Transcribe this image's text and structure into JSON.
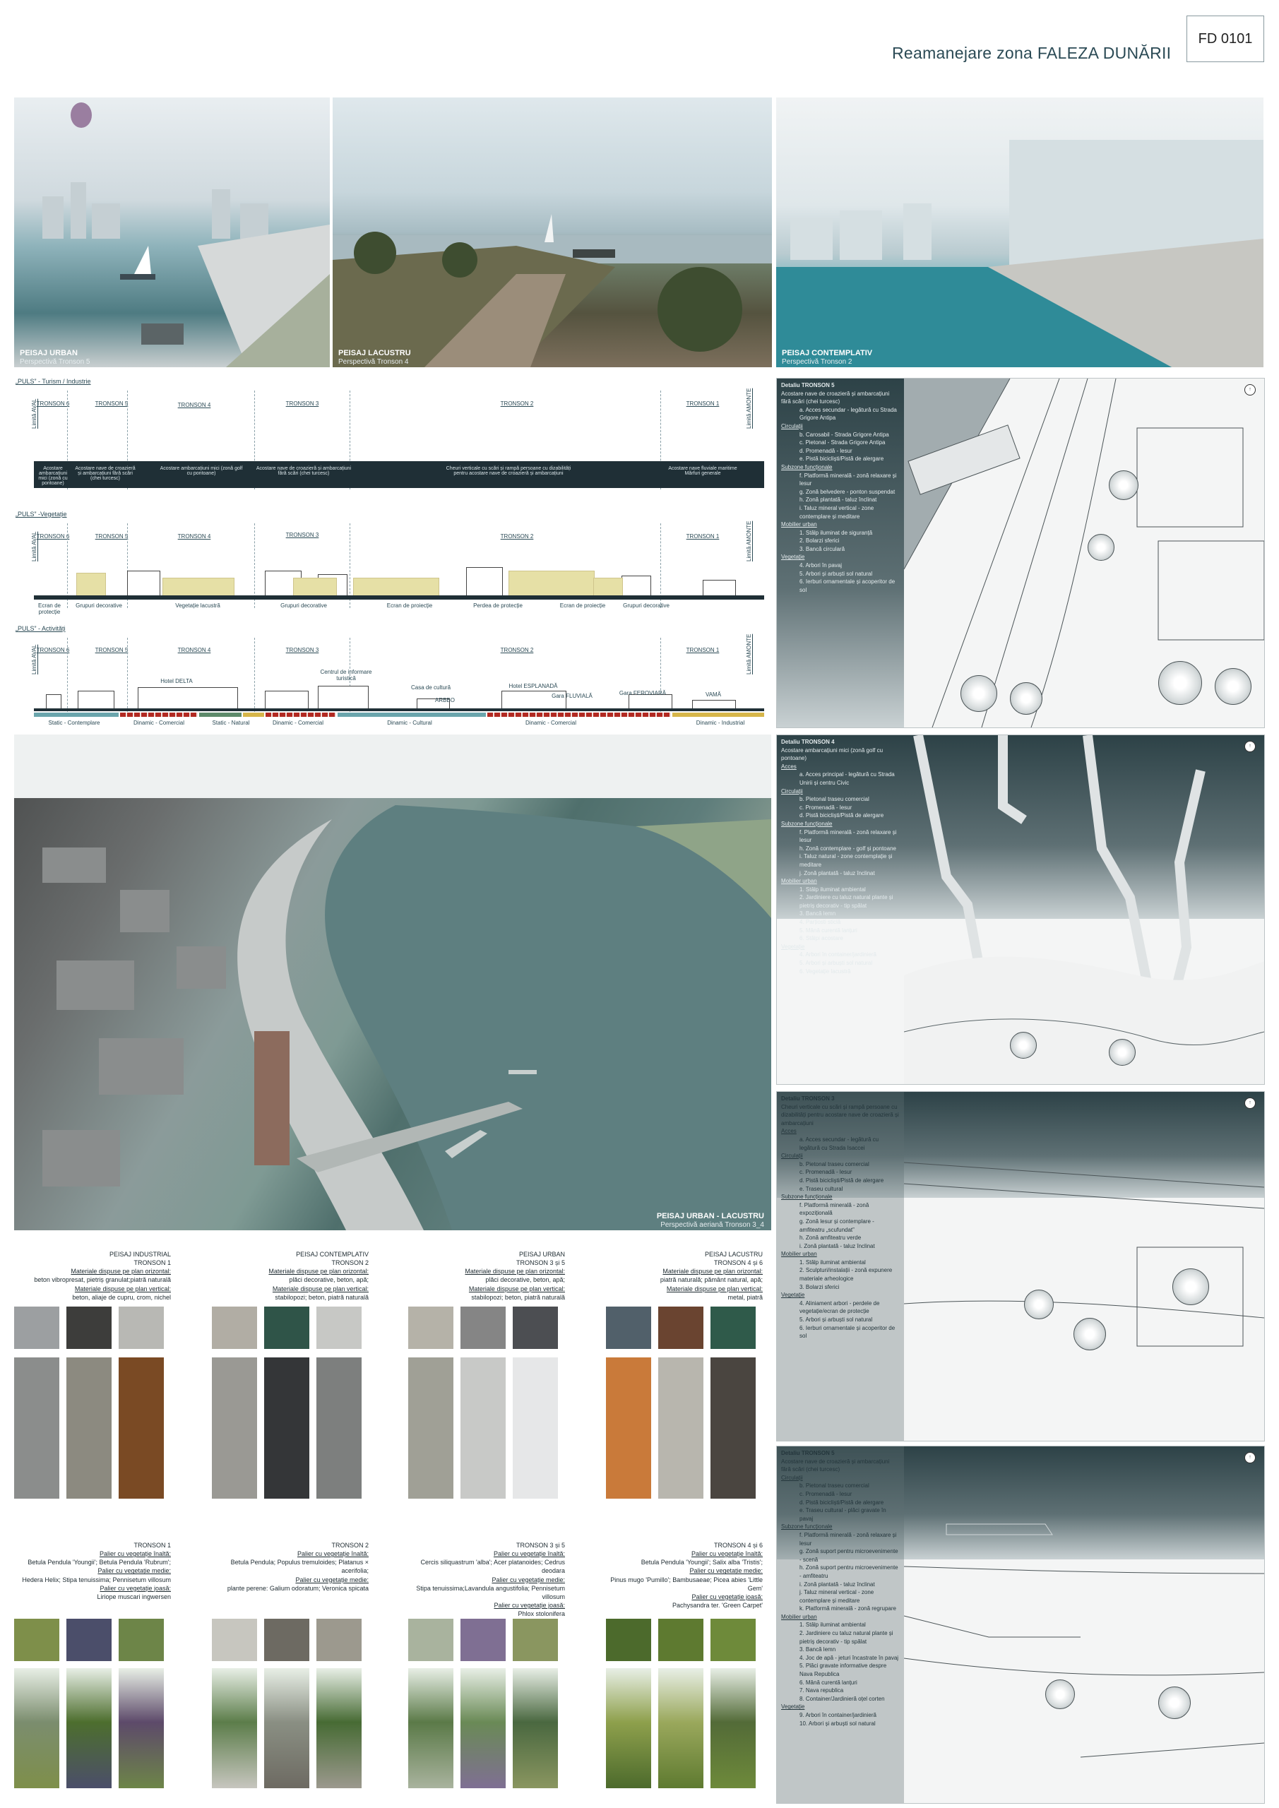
{
  "header": {
    "code": "FD 0101",
    "title": "Reamanejare zona FALEZA DUNĂRII"
  },
  "top_photos": [
    {
      "label": "PEISAJ URBAN",
      "sublabel": "Perspectivă Tronson 5"
    },
    {
      "label": "PEISAJ LACUSTRU",
      "sublabel": "Perspectivă Tronson 4"
    },
    {
      "label": "PEISAJ CONTEMPLATIV",
      "sublabel": "Perspectivă Tronson 2"
    }
  ],
  "sections": {
    "puls1": {
      "title": "„PULS” - Turism / Industrie"
    },
    "puls2": {
      "title": "„PULS” -Vegetație"
    },
    "puls3": {
      "title": "„PULS” - Activități"
    },
    "limit_left": "Limită AVAL",
    "limit_right": "Limită AMONTE",
    "tronsons": [
      "TRONSON 6",
      "TRONSON 5",
      "TRONSON 4",
      "TRONSON 3",
      "TRONSON 2",
      "TRONSON 1"
    ],
    "band1": [
      "Acostare ambarcațiuni mici (zonă cu pontoane)",
      "Acostare nave de croazieră și ambarcațiuni fără scări (chei turcesc)",
      "Acostare ambarcațiuni mici (zonă golf cu pontoane)",
      "Acostare nave de croazieră și ambarcațiuni fără scări (chei turcesc)",
      "Cheuri verticale cu scări și rampă persoane cu dizabilități pentru acostare nave de croazieră și ambarcațiuni",
      "Acostare nave fluviale maritime Mărfuri generale"
    ],
    "veg_caps": [
      "Ecran de protecție",
      "Grupuri decorative",
      "Vegetație lacustră",
      "Grupuri decorative",
      "Ecran de proiecție",
      "Perdea de protecție",
      "Ecran de proiecție",
      "Grupuri decorative"
    ],
    "act_labels": [
      "Hotel DELTA",
      "Centrul de informare turistică",
      "Casa de cultură",
      "ARBBO",
      "Hotel ESPLANADĂ",
      "Gara FLUVIALĂ",
      "Gara FEROVIARĂ",
      "VAMĂ"
    ],
    "act_caps": [
      "Static - Contemplare",
      "Dinamic - Comercial",
      "Static - Natural",
      "Dinamic - Comercial",
      "Dinamic - Cultural",
      "Dinamic - Comercial",
      "Dinamic - Industrial"
    ]
  },
  "aerial": {
    "label": "PEISAJ URBAN - LACUSTRU",
    "sublabel": "Perspectivă aeriană Tronson 3_4"
  },
  "details": [
    {
      "title": "Detaliu TRONSON 5",
      "subtitle": "Acostare nave de croazieră și ambarcațiuni fără scări (chei turcesc)",
      "lines": [
        "a. Acces secundar - legătură cu Strada Grigore Antipa",
        "Circulații",
        "b. Carosabil - Strada Grigore Antipa",
        "c. Pietonal - Strada Grigore Antipa",
        "d. Promenadă - lesur",
        "e. Pistă bicicliști/Pistă de alergare",
        "Subzone funcționale",
        "f. Platformă minerală - zonă relaxare și lesur",
        "g. Zonă belvedere - ponton suspendat",
        "h. Zonă plantată - taluz înclinat",
        "i. Taluz mineral vertical - zone contemplare și meditare",
        "Mobilier urban",
        "1. Stâlp iluminat de siguranță",
        "2. Bolarzi sferici",
        "3. Bancă circulară",
        "Vegetație",
        "4. Arbori în pavaj",
        "5. Arbori și arbuști sol natural",
        "6. Ierburi ornamentale și acoperitor de sol"
      ]
    },
    {
      "title": "Detaliu TRONSON 4",
      "subtitle": "Acostare ambarcațiuni mici (zonă golf cu pontoane)",
      "lines": [
        "Acces",
        "a. Acces principal - legătură cu Strada Unirii și centru Civic",
        "Circulații",
        "b. Pietonal traseu comercial",
        "c. Promenadă - lesur",
        "d. Pistă bicicliști/Pistă de alergare",
        "Subzone funcționale",
        "f. Platformă minerală - zonă relaxare și lesur",
        "h. Zonă contemplare - golf și pontoane",
        "i. Taluz natural - zone contemplație și meditare",
        "j. Zonă plantată - taluz înclinat",
        "Mobilier urban",
        "1. Stâlp iluminat ambiental",
        "2. Jardiniere cu taluz natural plante și pietriș decorativ - tip spălat",
        "3. Bancă lemn",
        "4. Parțiosti sticlă",
        "5. Mână curentă lanțuri",
        "6. Stâlpi acostare",
        "Vegetație",
        "4. Arbori în container/jardinieră",
        "5. Arbori și arbuști sol natural",
        "6. Vegetație lacustră"
      ]
    },
    {
      "title": "Detaliu TRONSON 3",
      "subtitle": "Cheuri verticale cu scări și rampă persoane cu dizabilități pentru acostare nave de croazieră și ambarcațiuni",
      "lines": [
        "Acces",
        "a. Acces secundar - legătură cu legătură cu Strada Isaccei",
        "Circulații",
        "b. Pietonal traseu comercial",
        "c. Promenadă - lesur",
        "d. Pistă bicicliști/Pistă de alergare",
        "e. Traseu cultural",
        "Subzone funcționale",
        "f. Platformă minerală - zonă expozițională",
        "g. Zonă lesur și contemplare - amfiteatru „scufundat”",
        "h. Zonă amfiteatru verde",
        "i. Zonă plantată - taluz înclinat",
        "Mobilier urban",
        "1. Stâlp iluminat ambiental",
        "2. Sculpturi/instalații - zonă expunere materiale arheologice",
        "3. Bolarzi sferici",
        "Vegetație",
        "4. Aliniament arbori - perdele de vegetație/ecran de protecție",
        "5. Arbori și arbuști sol natural",
        "6. Ierburi ornamentale și acoperitor de sol"
      ]
    },
    {
      "title": "Detaliu TRONSON 5",
      "subtitle": "Acostare nave de croazieră și ambarcațiuni fără scări (chei turcesc)",
      "lines": [
        "Circulații",
        "b. Pietonal traseu comercial",
        "c. Promenadă - lesur",
        "d. Pistă bicicliști/Pistă de alergare",
        "e. Traseu cultural - plăci gravate în pavaj",
        "Subzone funcționale",
        "f. Platformă minerală - zonă relaxare și lesur",
        "g. Zonă suport pentru microevenimente - scenă",
        "h. Zonă suport pentru microevenimente - amfiteatru",
        "i. Zonă plantată - taluz înclinat",
        "j. Taluz mineral vertical - zone contemplare și meditare",
        "k. Platformă minerală - zonă regrupare",
        "Mobilier urban",
        "1. Stâlp iluminat ambiental",
        "2. Jardiniere cu taluz natural plante și pietriș decorativ - tip spălat",
        "3. Bancă lemn",
        "4. Joc de apă - jeturi încastrate în pavaj",
        "5. Plăci gravate informative despre Nava Republica",
        "6. Mână curentă lanțuri",
        "7. Nava republica",
        "8. Container/Jardinieră oțel corten",
        "Vegetație",
        "9. Arbori în container/jardinieră",
        "10. Arbori și arbuști sol natural"
      ]
    }
  ],
  "materials": [
    {
      "name": "PEISAJ INDUSTRIAL",
      "tronson": "TRONSON 1",
      "h_label": "Materiale dispuse pe plan orizontal:",
      "h_text": "beton vibropresat, pietriș granulat;piatră naturală",
      "v_label": "Materiale dispuse pe plan vertical:",
      "v_text": "beton, aliaje de cupru, crom, nichel",
      "sw": [
        "#9c9fa1",
        "#3d3d3b",
        "#b8b8b4",
        "#8b8d8c",
        "#8c8a80",
        "#7a4a24"
      ]
    },
    {
      "name": "PEISAJ CONTEMPLATIV",
      "tronson": "TRONSON 2",
      "h_label": "Materiale dispuse pe plan orizontal:",
      "h_text": "plăci decorative, beton, apă;",
      "v_label": "Materiale dispuse pe plan vertical:",
      "v_text": "stabilopozi; beton, piatră naturală",
      "sw": [
        "#b1ada4",
        "#2f5448",
        "#c7c8c5",
        "#9a9994",
        "#343638",
        "#7d7f7e"
      ]
    },
    {
      "name": "PEISAJ URBAN",
      "tronson": "TRONSON 3 și 5",
      "h_label": "Materiale dispuse pe plan orizontal:",
      "h_text": "plăci decorative, beton, apă;",
      "v_label": "Materiale dispuse pe plan vertical:",
      "v_text": "stabilopozi; beton, piatră naturală",
      "sw": [
        "#b5b2a8",
        "#858585",
        "#4c4e52",
        "#a0a096",
        "#c8c9c7",
        "#e6e7e8"
      ]
    },
    {
      "name": "PEISAJ LACUSTRU",
      "tronson": "TRONSON 4 și 6",
      "h_label": "Materiale dispuse pe plan orizontal:",
      "h_text": "piatră naturală; pământ natural, apă;",
      "v_label": "Materiale dispuse pe plan vertical:",
      "v_text": "metal, piatră",
      "sw": [
        "#51606a",
        "#6a4430",
        "#2f5a4a",
        "#c97a3a",
        "#b8b6ae",
        "#4a4540"
      ]
    }
  ],
  "vegetation": [
    {
      "tronson": "TRONSON 1",
      "lines": [
        "Palier cu vegetație înaltă:",
        "Betula Pendula 'Youngii'; Betula Pendula 'Rubrum';",
        "Palier cu vegetație medie:",
        "Hedera Helix; Stipa tenuissima; Pennisetum villosum",
        "Palier cu vegetație joasă:",
        "Liriope muscari ingwersen"
      ],
      "sw": [
        "#7e8f4a",
        "#4b4e6a",
        "#6d8548",
        "#7b8d6e",
        "#4d6e2e",
        "#5d4a6a"
      ]
    },
    {
      "tronson": "TRONSON 2",
      "lines": [
        "Palier cu vegetație înaltă:",
        "Betula Pendula; Populus tremuloides; Platanus × acerifolia;",
        "Palier cu vegetație medie:",
        "plante perene: Galium odoratum; Veronica spicata"
      ],
      "sw": [
        "#c7c6bf",
        "#6d6a62",
        "#9c998e",
        "#5c7d4a",
        "#8a8f83",
        "#476b34"
      ]
    },
    {
      "tronson": "TRONSON 3 și 5",
      "lines": [
        "Palier cu vegetație înaltă:",
        "Cercis siliquastrum 'alba'; Acer platanoides; Cedrus deodara",
        "Palier cu vegetație medie:",
        "Stipa tenuissima;Lavandula angustifolia; Pennisetum villosum",
        "Palier cu vegetație joasă:",
        "Phlox stolonifera"
      ],
      "sw": [
        "#a9b39e",
        "#7f6f93",
        "#8a9660",
        "#5b7a48",
        "#6a8a56",
        "#4a6840"
      ]
    },
    {
      "tronson": "TRONSON 4 și 6",
      "lines": [
        "Palier cu vegetație înaltă:",
        "Betula Pendula 'Youngii'; Salix alba 'Tristis';",
        "Palier cu vegetație medie:",
        "Pinus mugo 'Pumillo'; Bambusaeae; Picea abies 'Little Gem'",
        "Palier cu vegetație joasă:",
        "Pachysandra ter. 'Green Carpet'"
      ],
      "sw": [
        "#4c6a2c",
        "#5e7a30",
        "#6e8a3a",
        "#8ea04c",
        "#9aa85c",
        "#536b38"
      ]
    }
  ]
}
